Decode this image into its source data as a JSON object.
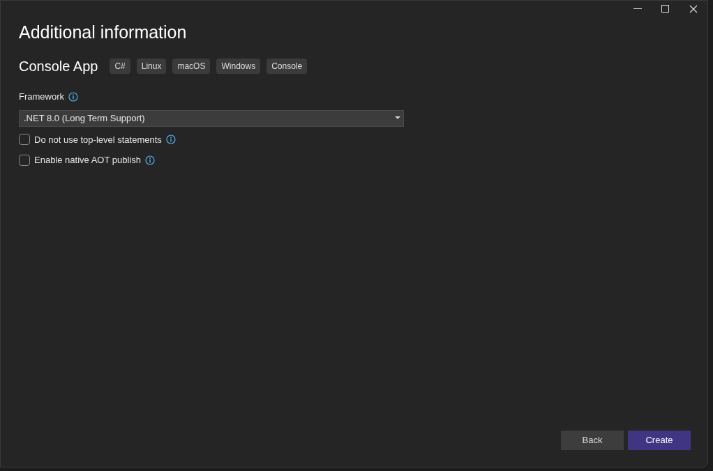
{
  "window": {
    "title": "Additional information"
  },
  "template": {
    "name": "Console App",
    "tags": [
      "C#",
      "Linux",
      "macOS",
      "Windows",
      "Console"
    ]
  },
  "framework": {
    "label": "Framework",
    "value": ".NET 8.0 (Long Term Support)"
  },
  "options": [
    {
      "label": "Do not use top-level statements",
      "checked": false
    },
    {
      "label": "Enable native AOT publish",
      "checked": false
    }
  ],
  "buttons": [
    {
      "label": "Back",
      "kind": "secondary"
    },
    {
      "label": "Create",
      "kind": "primary"
    }
  ]
}
